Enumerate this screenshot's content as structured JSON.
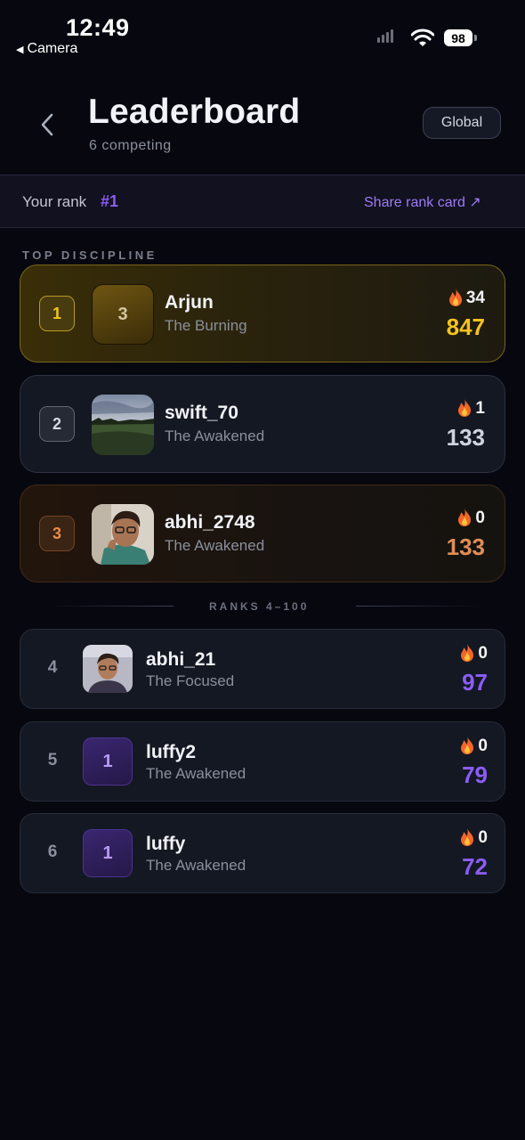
{
  "status_bar": {
    "time": "12:49",
    "back_app": "Camera",
    "battery": "98"
  },
  "header": {
    "title": "Leaderboard",
    "subtitle": "6 competing",
    "scope_button": "Global"
  },
  "rank_bar": {
    "label": "Your rank",
    "value": "#1",
    "share_label": "Share rank card ↗"
  },
  "section_title": "TOP DISCIPLINE",
  "divider_label": "RANKS 4–100",
  "top_players": [
    {
      "position": "1",
      "avatar_text": "3",
      "name": "Arjun",
      "tier": "The Burning",
      "streak": "34",
      "score": "847"
    },
    {
      "position": "2",
      "avatar_image": "field-landscape-photo",
      "name": "swift_70",
      "tier": "The Awakened",
      "streak": "1",
      "score": "133"
    },
    {
      "position": "3",
      "avatar_image": "person-selfie-photo",
      "name": "abhi_2748",
      "tier": "The Awakened",
      "streak": "0",
      "score": "133"
    }
  ],
  "other_players": [
    {
      "position": "4",
      "avatar_image": "person-portrait-photo",
      "name": "abhi_21",
      "tier": "The Focused",
      "streak": "0",
      "score": "97"
    },
    {
      "position": "5",
      "avatar_text": "1",
      "name": "luffy2",
      "tier": "The Awakened",
      "streak": "0",
      "score": "79"
    },
    {
      "position": "6",
      "avatar_text": "1",
      "name": "luffy",
      "tier": "The Awakened",
      "streak": "0",
      "score": "72"
    }
  ],
  "icons": {
    "back": "chevron-left-icon",
    "streak": "flame-icon",
    "wifi": "wifi-icon",
    "signal": "cellular-signal-icon",
    "battery": "battery-icon"
  },
  "colors": {
    "accent": "#8b5cf6",
    "gold": "#f6c21f",
    "bronze": "#e08e55",
    "background": "#07080f"
  }
}
